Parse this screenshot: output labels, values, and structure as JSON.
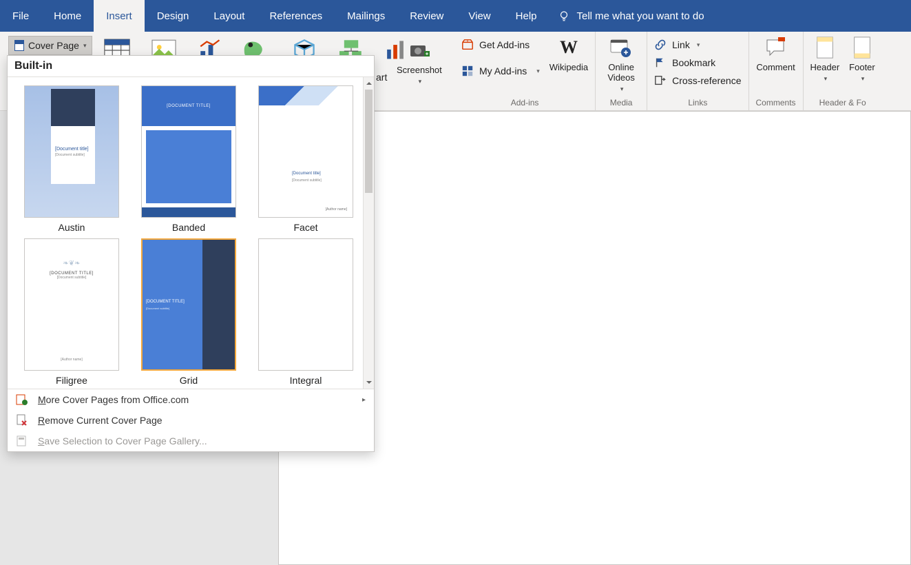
{
  "tabs": {
    "file": "File",
    "home": "Home",
    "insert": "Insert",
    "design": "Design",
    "layout": "Layout",
    "references": "References",
    "mailings": "Mailings",
    "review": "Review",
    "view": "View",
    "help": "Help"
  },
  "tellme": "Tell me what you want to do",
  "cover_page_btn": "Cover Page",
  "ribbon": {
    "art_partial": "art",
    "screenshot": "Screenshot",
    "get_addins": "Get Add-ins",
    "my_addins": "My Add-ins",
    "wikipedia": "Wikipedia",
    "addins_group": "Add-ins",
    "online_videos": "Online Videos",
    "media_group": "Media",
    "link": "Link",
    "bookmark": "Bookmark",
    "cross_ref": "Cross-reference",
    "links_group": "Links",
    "comment": "Comment",
    "comments_group": "Comments",
    "header": "Header",
    "footer": "Footer",
    "hf_group": "Header & Fo"
  },
  "dropdown": {
    "section": "Built-in",
    "templates": [
      {
        "name": "Austin"
      },
      {
        "name": "Banded"
      },
      {
        "name": "Facet"
      },
      {
        "name": "Filigree"
      },
      {
        "name": "Grid"
      },
      {
        "name": "Integral"
      }
    ],
    "thumb_text": {
      "doc_title": "[Document title]",
      "doc_title_caps": "[DOCUMENT TITLE]",
      "doc_subtitle": "[Document subtitle]",
      "author": "[Author name]"
    },
    "more": "More Cover Pages from Office.com",
    "more_u": "M",
    "remove": "Remove Current Cover Page",
    "remove_u": "R",
    "save": "Save Selection to Cover Page Gallery...",
    "save_u": "S"
  }
}
